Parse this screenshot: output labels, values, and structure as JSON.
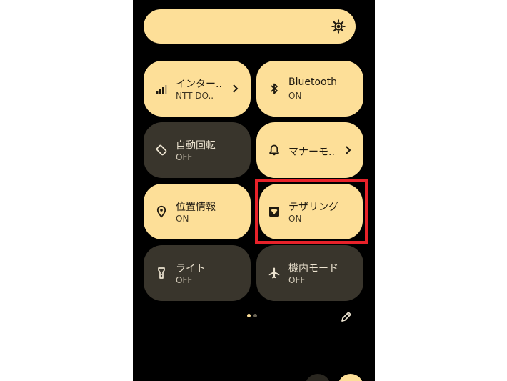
{
  "colors": {
    "tile_on": "#fddf98",
    "tile_off": "#39352c",
    "highlight": "#e8222a",
    "panel_bg": "#000000"
  },
  "tiles": [
    {
      "id": "mobile-data",
      "title": "インター..",
      "subtitle": "NTT DO..",
      "state": "on",
      "icon": "signal-icon",
      "has_chevron": true
    },
    {
      "id": "bluetooth",
      "title": "Bluetooth",
      "subtitle": "ON",
      "state": "on",
      "icon": "bluetooth-icon",
      "has_chevron": false
    },
    {
      "id": "auto-rotate",
      "title": "自動回転",
      "subtitle": "OFF",
      "state": "off",
      "icon": "rotate-icon",
      "has_chevron": false
    },
    {
      "id": "manner-mode",
      "title": "マナーモ..",
      "subtitle": "",
      "state": "on",
      "icon": "bell-icon",
      "has_chevron": true
    },
    {
      "id": "location",
      "title": "位置情報",
      "subtitle": "ON",
      "state": "on",
      "icon": "location-pin-icon",
      "has_chevron": false
    },
    {
      "id": "tethering",
      "title": "テザリング",
      "subtitle": "ON",
      "state": "on",
      "icon": "hotspot-icon",
      "has_chevron": false,
      "highlighted": true
    },
    {
      "id": "flashlight",
      "title": "ライト",
      "subtitle": "OFF",
      "state": "off",
      "icon": "flashlight-icon",
      "has_chevron": false
    },
    {
      "id": "airplane-mode",
      "title": "機内モード",
      "subtitle": "OFF",
      "state": "off",
      "icon": "airplane-icon",
      "has_chevron": false
    }
  ],
  "brightness": {
    "icon": "brightness-icon"
  },
  "pager": {
    "page_count": 2,
    "current_page": 1
  },
  "footer": {
    "edit_icon": "pencil-icon"
  }
}
